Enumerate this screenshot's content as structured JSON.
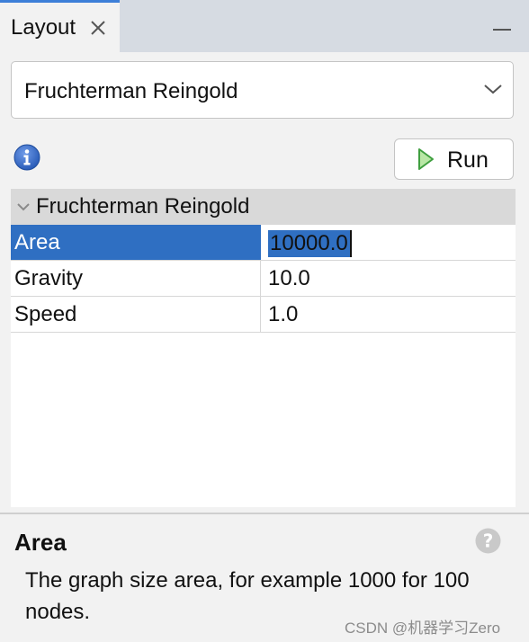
{
  "tab": {
    "label": "Layout"
  },
  "layout_select": {
    "selected": "Fruchterman Reingold"
  },
  "toolbar": {
    "run_label": "Run"
  },
  "properties": {
    "group": "Fruchterman Reingold",
    "rows": [
      {
        "name": "Area",
        "value": "10000.0"
      },
      {
        "name": "Gravity",
        "value": "10.0"
      },
      {
        "name": "Speed",
        "value": "1.0"
      }
    ]
  },
  "description": {
    "title": "Area",
    "text": "The graph size area, for example 1000 for 100 nodes."
  },
  "watermark": "CSDN @机器学习Zero",
  "colors": {
    "selection": "#2f6fc2",
    "tab_accent": "#3d7fd8",
    "run_icon": "#4cb04c",
    "info_icon": "#2f66c6"
  },
  "icons": {
    "close": "close-icon",
    "minimize": "minimize-icon",
    "dropdown": "chevron-down-icon",
    "info": "info-icon",
    "run": "play-icon",
    "help": "help-icon"
  }
}
